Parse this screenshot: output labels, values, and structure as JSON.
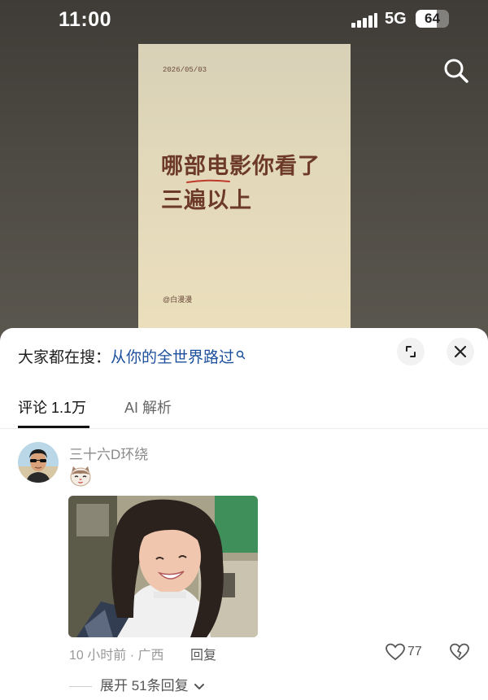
{
  "status_bar": {
    "time": "11:00",
    "network": "5G",
    "battery": "64",
    "battery_level": 0.64
  },
  "poster": {
    "date": "2026/05/03",
    "title_line1": "哪部电影你看了",
    "title_line2": "三遍以上",
    "signature": "@白漫漫"
  },
  "sheet": {
    "search_prefix": "大家都在搜：",
    "search_keyword": "从你的全世界路过",
    "tabs": [
      {
        "label": "评论 1.1万",
        "active": true
      },
      {
        "label": "AI 解析",
        "active": false
      }
    ]
  },
  "comment": {
    "username": "三十六D环绕",
    "meta": "10 小时前 · 广西",
    "reply_label": "回复",
    "like_count": "77",
    "expand_label": "展开 51条回复"
  },
  "icons": [
    "search-icon",
    "expand-icon",
    "close-icon",
    "search-mini-icon",
    "heart-icon",
    "broken-heart-icon",
    "chevron-down-icon",
    "cat-sticker-icon"
  ],
  "colors": {
    "keyword": "#1c4f9c",
    "poster_text": "#6d3a2a",
    "accent_underline": "#c0392b"
  }
}
